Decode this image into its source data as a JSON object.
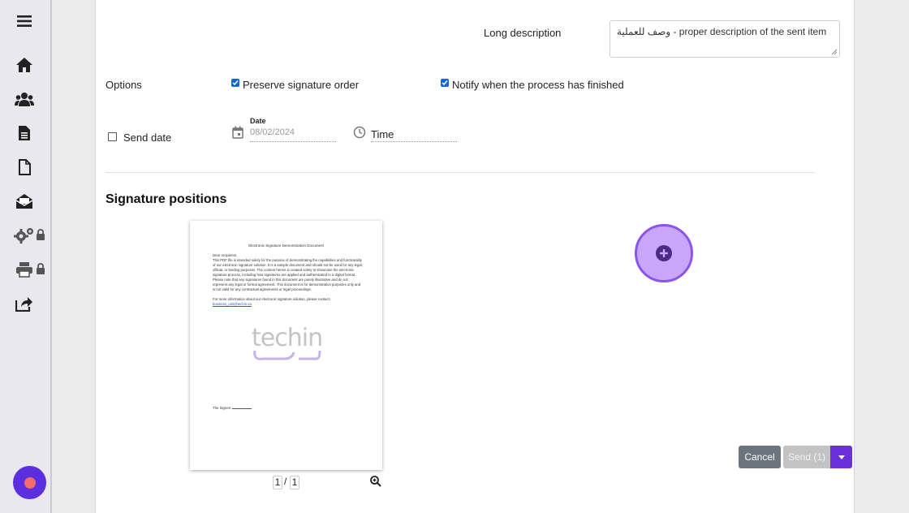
{
  "sidebar": {
    "items": [
      {
        "icon": "menu-icon"
      },
      {
        "icon": "home-icon"
      },
      {
        "icon": "users-icon"
      },
      {
        "icon": "document-text-icon"
      },
      {
        "icon": "file-icon"
      },
      {
        "icon": "mail-open-icon"
      },
      {
        "icon": "gears-icon",
        "locked": true
      },
      {
        "icon": "printer-icon",
        "locked": true
      },
      {
        "icon": "share-icon"
      }
    ],
    "record_icon": "record-icon"
  },
  "form": {
    "long_description_label": "Long description",
    "long_description_value": "وصف للعملية - proper description of the sent item",
    "options_label": "Options",
    "preserve_signature_order_label": "Preserve signature order",
    "preserve_signature_order_checked": true,
    "notify_finished_label": "Notify when the process has finished",
    "notify_finished_checked": true,
    "send_date_label": "Send date",
    "send_date_checked": false,
    "date_label": "Date",
    "date_placeholder": "08/02/2024",
    "time_placeholder": "Time"
  },
  "signature_positions": {
    "title": "Signature positions",
    "document": {
      "title": "Electronic Signature Demonstration Document",
      "greeting": "Dear recipients,",
      "body": "This PDF file is intended solely for the purpose of demonstrating the capabilities and functionality of our electronic signature solution. It is a sample document and should not be used for any legal, official, or binding purposes. The content herein is created solely to showcase the electronic signature process, including how signatures are applied and authenticated in a digital format. Please note that any signatures found in this document are purely illustrative and do not represent any legal or formal agreement. This document is for demonstration purposes only and is not valid for any contractual agreements or legal proceedings.",
      "contact": "For more information about our electronic signature solution, please contact:",
      "email": "business_unit@techin.sa",
      "logo_text": "techin",
      "signee_label": "The Signee:"
    },
    "pager": {
      "current": "1",
      "separator": "/",
      "total": "1"
    },
    "zoom_icon": "zoom-in-icon",
    "add_icon": "plus-circle-icon"
  },
  "actions": {
    "cancel_label": "Cancel",
    "send_label": "Send (1)",
    "dropdown_icon": "caret-down-icon"
  },
  "colors": {
    "primary": "#6a2fd6",
    "checkbox": "#1565d8",
    "add_button": "#c9a6f8",
    "cancel": "#6c757d"
  }
}
